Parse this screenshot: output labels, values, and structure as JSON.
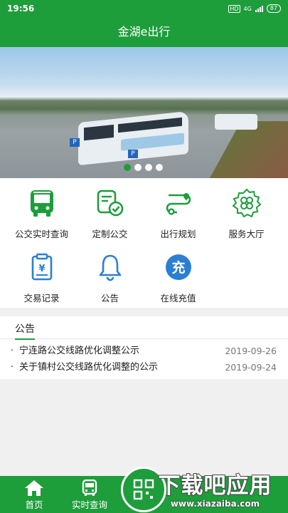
{
  "status_bar": {
    "time": "19:56",
    "hd": "HD",
    "network": "4G",
    "battery": "87"
  },
  "header": {
    "title": "金湖e出行"
  },
  "banner": {
    "sign_text": "P",
    "slides": 4,
    "active_slide": 1
  },
  "menu": {
    "items": [
      {
        "label": "公交实时查询",
        "icon": "bus-icon"
      },
      {
        "label": "定制公交",
        "icon": "custom-bus-icon"
      },
      {
        "label": "出行规划",
        "icon": "route-plan-icon"
      },
      {
        "label": "服务大厅",
        "icon": "service-hall-icon"
      },
      {
        "label": "交易记录",
        "icon": "transaction-record-icon"
      },
      {
        "label": "公告",
        "icon": "bell-icon"
      },
      {
        "label": "在线充值",
        "icon": "recharge-icon",
        "icon_text": "充"
      }
    ]
  },
  "notices": {
    "title": "公告",
    "items": [
      {
        "title": "宁连路公交线路优化调整公示",
        "date": "2019-09-26"
      },
      {
        "title": "关于镇村公交线路优化调整的公示",
        "date": "2019-09-24"
      }
    ]
  },
  "tabbar": {
    "items": [
      {
        "label": "首页",
        "icon": "home-icon"
      },
      {
        "label": "实时查询",
        "icon": "bus-icon"
      }
    ],
    "center": {
      "icon": "scan-icon"
    }
  },
  "watermark": {
    "text": "下载吧应用",
    "url": "www.xiazaiba.com"
  },
  "colors": {
    "primary": "#1e9d3b",
    "icon_blue": "#2a7fd4",
    "background": "#f0f0f0"
  }
}
